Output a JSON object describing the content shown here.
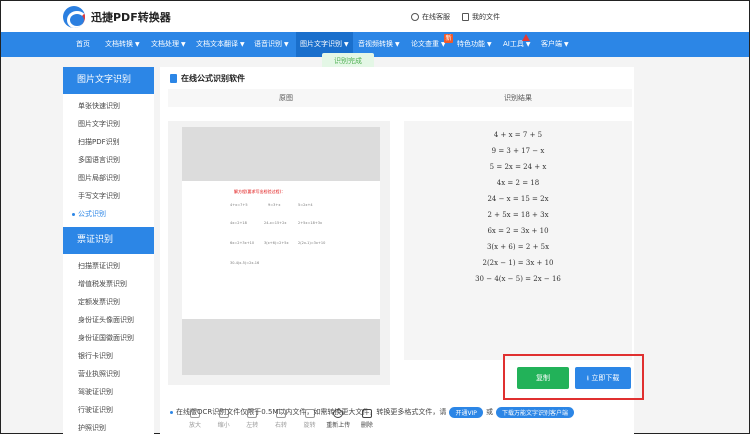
{
  "header": {
    "logo_text": "迅捷PDF转换器",
    "links": [
      "在线客服",
      "我的文件"
    ]
  },
  "nav": {
    "items": [
      {
        "label": "首页",
        "caret": false
      },
      {
        "label": "文档转换",
        "caret": true
      },
      {
        "label": "文档处理",
        "caret": true
      },
      {
        "label": "文档文本翻译",
        "caret": true
      },
      {
        "label": "语音识别",
        "caret": true
      },
      {
        "label": "图片文字识别",
        "caret": true,
        "active": true
      },
      {
        "label": "音视频转换",
        "caret": true
      },
      {
        "label": "论文查重",
        "caret": true,
        "badge": "新"
      },
      {
        "label": "特色功能",
        "caret": true
      },
      {
        "label": "AI工具",
        "caret": true
      },
      {
        "label": "客户端",
        "caret": true
      }
    ],
    "tooltip": "识别完成"
  },
  "sidebar": {
    "section1_title": "图片文字识别",
    "section1_items": [
      "单张快速识别",
      "图片文字识别",
      "扫描PDF识别",
      "多国语言识别",
      "图片局部识别",
      "手写文字识别",
      "公式识别"
    ],
    "active_item": "公式识别",
    "section2_title": "票证识别",
    "section2_items": [
      "扫描票证识别",
      "增值税发票识别",
      "定额发票识别",
      "身份证头像面识别",
      "身份证国徽面识别",
      "银行卡识别",
      "营业执照识别",
      "驾驶证识别",
      "行驶证识别",
      "护照识别"
    ]
  },
  "main": {
    "title": "在线公式识别软件",
    "col_original": "原图",
    "col_result": "识别结果",
    "preview": {
      "page_title": "解方程(要求写出检验过程)：",
      "equations": [
        "4+x=7+5",
        "9=3+x",
        "5=2x+4",
        "4x=2+18",
        "24-x=15+2x",
        "2+5x=18+3x",
        "6x=2+3x+10",
        "3(x+6)=2+5x",
        "2(2x-1)=3x+10",
        "30-4(x-5)=2x-16",
        "",
        ""
      ]
    },
    "toolbar": [
      "放大",
      "缩小",
      "左转",
      "右转",
      "旋转",
      "重新上传",
      "删除"
    ],
    "results": [
      "4 + x = 7 + 5",
      "9 = 3 + 17 − x",
      "5 = 2x = 24 + x",
      "4x = 2 = 18",
      "24 − x = 15 = 2x",
      "2 + 5x = 18 + 3x",
      "6x = 2 = 3x + 10",
      "3(x + 6) = 2 + 5x",
      "2(2x − 1) = 3x + 10",
      "30 − 4(x − 5) = 2x − 16"
    ],
    "copy_label": "复制",
    "download_label": "立即下载",
    "note_text": "在线版OCR识别文件仅限于0.5M以内文件，如需转换更大文件，转换更多格式文件，请",
    "note_vip": "开通VIP",
    "note_or": "或",
    "note_client": "下载万能文字识别客户端"
  },
  "colors": {
    "brand_blue": "#2c86e6",
    "copy_green": "#22b259",
    "highlight_red": "#e03030"
  }
}
